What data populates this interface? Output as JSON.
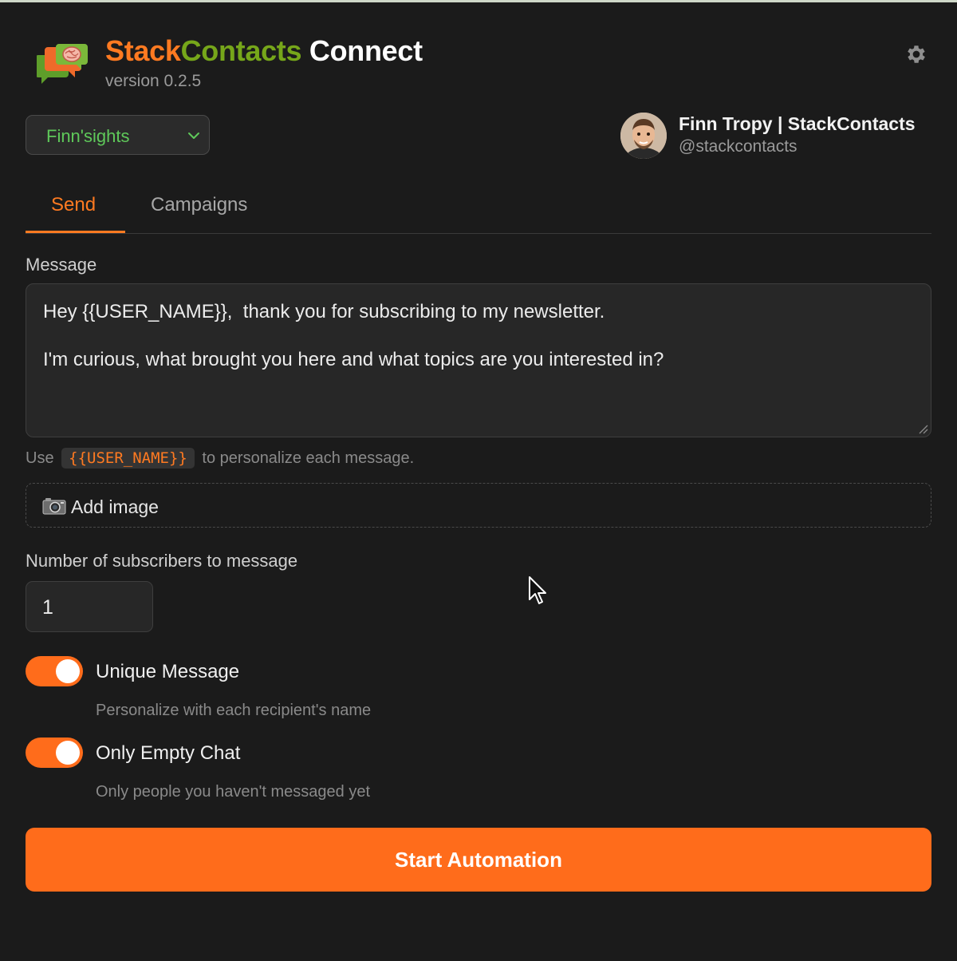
{
  "header": {
    "brand_part1": "Stack",
    "brand_part2": "Contacts",
    "brand_part3": " Connect",
    "version": "version 0.2.5",
    "icons": [
      "chat-bubbles-brain-logo",
      "gear-icon"
    ]
  },
  "account": {
    "selected": "Finn'sights",
    "profile_name": "Finn Tropy | StackContacts",
    "profile_handle": "@stackcontacts"
  },
  "tabs": {
    "send": "Send",
    "campaigns": "Campaigns",
    "active": "Send"
  },
  "message": {
    "label": "Message",
    "line1": "Hey {{USER_NAME}},  thank you for subscribing to my newsletter.",
    "line2": "I'm curious, what brought you here and what topics are you interested in?",
    "hint_prefix": "Use",
    "hint_code": "{{USER_NAME}}",
    "hint_suffix": "to personalize each message."
  },
  "add_image": {
    "label": "Add image"
  },
  "subscribers": {
    "label": "Number of subscribers to message",
    "value": "1"
  },
  "options": {
    "unique_title": "Unique Message",
    "unique_desc": "Personalize with each recipient's name",
    "unique_on": true,
    "empty_title": "Only Empty Chat",
    "empty_desc": "Only people you haven't messaged yet",
    "empty_on": true
  },
  "actions": {
    "start": "Start Automation"
  },
  "colors": {
    "accent": "#ff6c1b",
    "brand_green": "#76a61a",
    "background": "#1b1b1b"
  }
}
